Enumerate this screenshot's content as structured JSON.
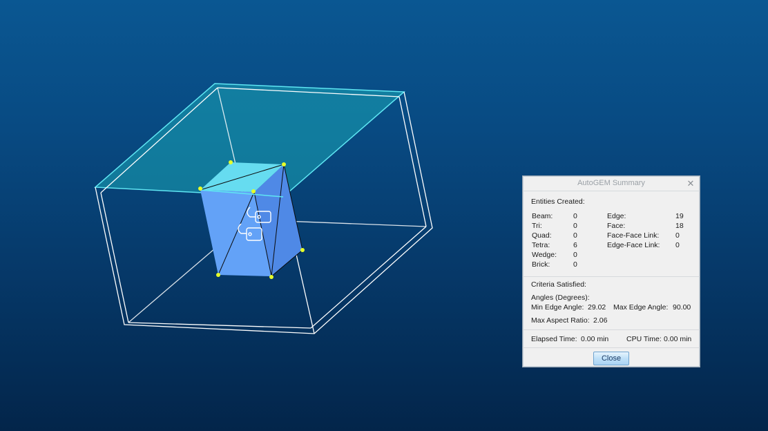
{
  "dialog": {
    "title": "AutoGEM Summary",
    "close_glyph": "✕",
    "entities_header": "Entities Created:",
    "entities_left": [
      {
        "label": "Beam:",
        "value": "0"
      },
      {
        "label": "Tri:",
        "value": "0"
      },
      {
        "label": "Quad:",
        "value": "0"
      },
      {
        "label": "Tetra:",
        "value": "6"
      },
      {
        "label": "Wedge:",
        "value": "0"
      },
      {
        "label": "Brick:",
        "value": "0"
      }
    ],
    "entities_right": [
      {
        "label": "Edge:",
        "value": "19"
      },
      {
        "label": "Face:",
        "value": "18"
      },
      {
        "label": "Face-Face Link:",
        "value": "0"
      },
      {
        "label": "Edge-Face Link:",
        "value": "0"
      }
    ],
    "criteria_header": "Criteria Satisfied:",
    "angles_header": "Angles (Degrees):",
    "min_edge_angle_label": "Min Edge Angle:",
    "min_edge_angle_value": "29.02",
    "max_edge_angle_label": "Max Edge Angle:",
    "max_edge_angle_value": "90.00",
    "max_aspect_ratio_label": "Max Aspect Ratio:",
    "max_aspect_ratio_value": "2.06",
    "elapsed_time_label": "Elapsed Time:",
    "elapsed_time_value": "0.00 min",
    "cpu_time_label": "CPU Time:",
    "cpu_time_value": "0.00 min",
    "close_button_label": "Close"
  },
  "viewport": {
    "background_top": "#0a5792",
    "background_bottom": "#03254a",
    "outer_box_color": "#ffffff",
    "highlight_surface_color": "#2fc6d6",
    "solid_front_color": "#5c9cf5",
    "solid_side_color": "#4a82e0",
    "solid_top_color": "#62d8ee",
    "node_color": "#e6ff29",
    "icons": [
      "constraint-tag-icon",
      "constraint-tag-icon"
    ]
  }
}
